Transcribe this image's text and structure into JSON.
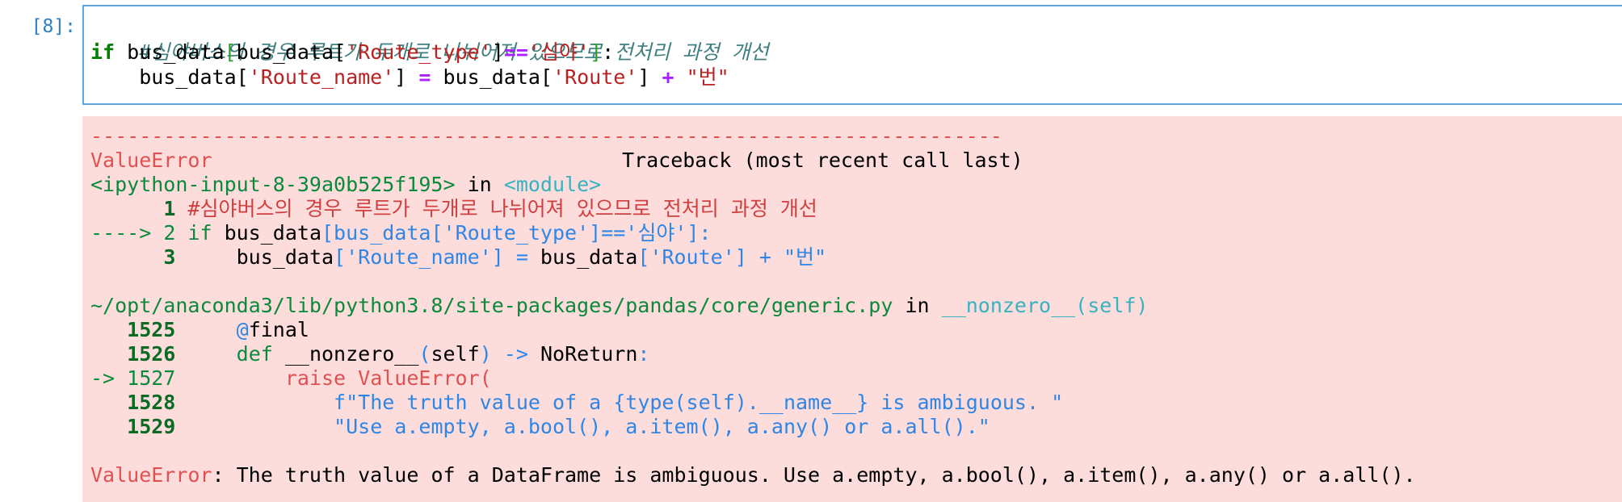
{
  "cell": {
    "prompt": "[8]:",
    "code": {
      "comment": "#심야버스의 경우 루트가 두개로 나뉘어져 있으므로 전처리 과정 개선",
      "line2": {
        "kw": "if",
        "a": " bus_data",
        "b": "[",
        "c": "bus_data[",
        "d": "'Route_type'",
        "e": "]",
        "f": "==",
        "g": "'심야'",
        "h": "]",
        "i": ":"
      },
      "line3": {
        "a": "    bus_data[",
        "b": "'Route_name'",
        "c": "] ",
        "d": "=",
        "e": " bus_data[",
        "f": "'Route'",
        "g": "] ",
        "h": "+",
        "i": " ",
        "j": "\"번\""
      }
    }
  },
  "traceback": {
    "dashes": "---------------------------------------------------------------------------",
    "error_name": "ValueError",
    "header_right": "Traceback (most recent call last)",
    "frame1": {
      "file": "<ipython-input-8-39a0b525f195>",
      "in": " in ",
      "func": "<module>",
      "lines": [
        {
          "prefix": "      ",
          "num": "1",
          "code": " #심야버스의 경우 루트가 두개로 나뉘어져 있으므로 전처리 과정 개선"
        },
        {
          "prefix": "----> ",
          "num": "2",
          "kw": " if",
          "a": " bus_data",
          "b": "[bus_data['Route_type']=='심야']:"
        },
        {
          "prefix": "      ",
          "num": "3",
          "a": "     bus_data",
          "b": "['Route_name'] = ",
          "c": "bus_data",
          "d": "['Route'] + \"번\""
        }
      ]
    },
    "frame2": {
      "file": "~/opt/anaconda3/lib/python3.8/site-packages/pandas/core/generic.py",
      "in": " in ",
      "func": "__nonzero__(self)",
      "lines": [
        {
          "prefix": "   ",
          "num": "1525",
          "a": "     ",
          "b": "@",
          "c": "final"
        },
        {
          "prefix": "   ",
          "num": "1526",
          "a": "     ",
          "b": "def",
          "c": " __nonzero__",
          "d": "(",
          "e": "self",
          "f": ")",
          "g": " -> ",
          "h": "NoReturn",
          "i": ":"
        },
        {
          "prefix": "-> ",
          "num": "1527",
          "a": "         ",
          "b": "raise ValueError("
        },
        {
          "prefix": "   ",
          "num": "1528",
          "a": "             ",
          "b": "f\"The truth value of a {type(self).__name__} is ambiguous. \""
        },
        {
          "prefix": "   ",
          "num": "1529",
          "a": "             ",
          "b": "\"Use a.empty, a.bool(), a.item(), a.any() or a.all().\""
        }
      ]
    },
    "final": {
      "name": "ValueError",
      "message": ": The truth value of a DataFrame is ambiguous. Use a.empty, a.bool(), a.item(), a.any() or a.all()."
    }
  }
}
